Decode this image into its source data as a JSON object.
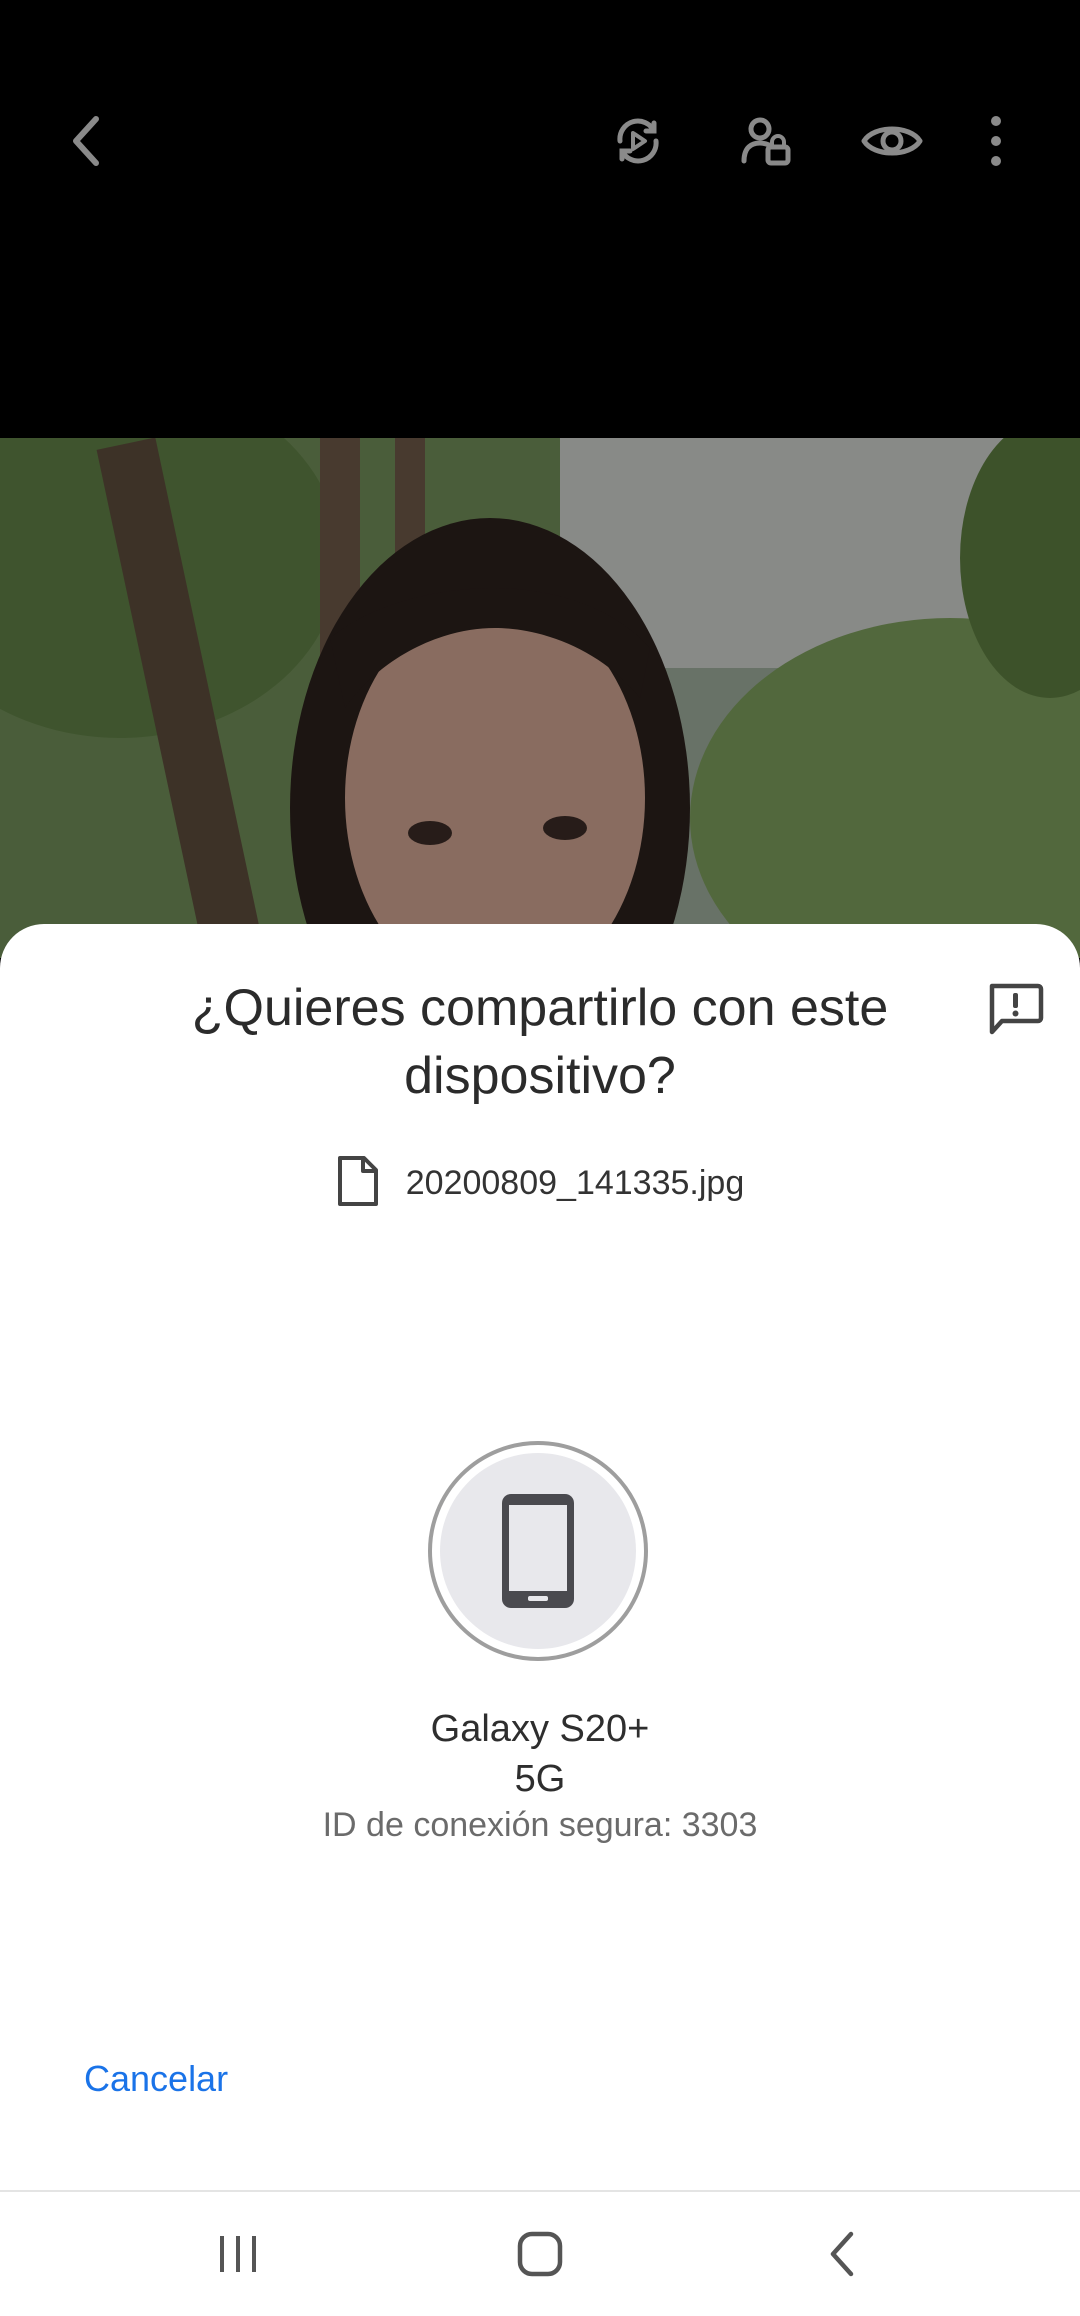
{
  "topbar": {
    "icons": [
      "back-icon",
      "motion-photo-icon",
      "people-tag-icon",
      "eye-icon",
      "more-vert-icon"
    ]
  },
  "dialog": {
    "title_line1": "¿Quieres compartirlo con este",
    "title_line2": "dispositivo?",
    "feedback_icon": "feedback-icon",
    "file_name": "20200809_141335.jpg",
    "device": {
      "name_line1": "Galaxy S20+",
      "name_line2": "5G",
      "icon": "smartphone-icon"
    },
    "secure_id_label": "ID de conexión segura:",
    "secure_id_value": "3303",
    "cancel_label": "Cancelar"
  },
  "colors": {
    "accent": "#1a73e8",
    "sheet_bg": "#ffffff",
    "topbar_bg": "#000000"
  },
  "navbar": {
    "icons": [
      "recents-icon",
      "home-icon",
      "nav-back-icon"
    ]
  }
}
